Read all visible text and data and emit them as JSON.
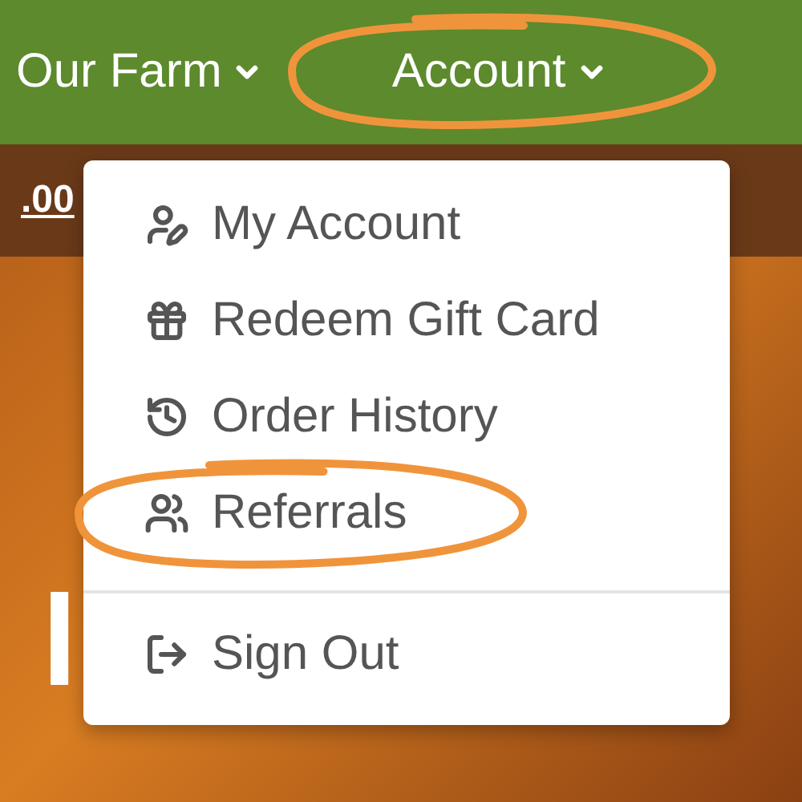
{
  "nav": [
    {
      "label": "Our Farm",
      "highlighted": false
    },
    {
      "label": "Account",
      "highlighted": true
    }
  ],
  "cart_total": ".00",
  "hero_heading": "l",
  "account_menu": [
    {
      "kind": "profile",
      "label": "My Account",
      "highlighted": false
    },
    {
      "kind": "gift",
      "label": "Redeem Gift Card",
      "highlighted": false
    },
    {
      "kind": "history",
      "label": "Order History",
      "highlighted": false
    },
    {
      "kind": "referrals",
      "label": "Referrals",
      "highlighted": true
    },
    {
      "kind": "signout",
      "label": "Sign Out",
      "highlighted": false
    }
  ]
}
